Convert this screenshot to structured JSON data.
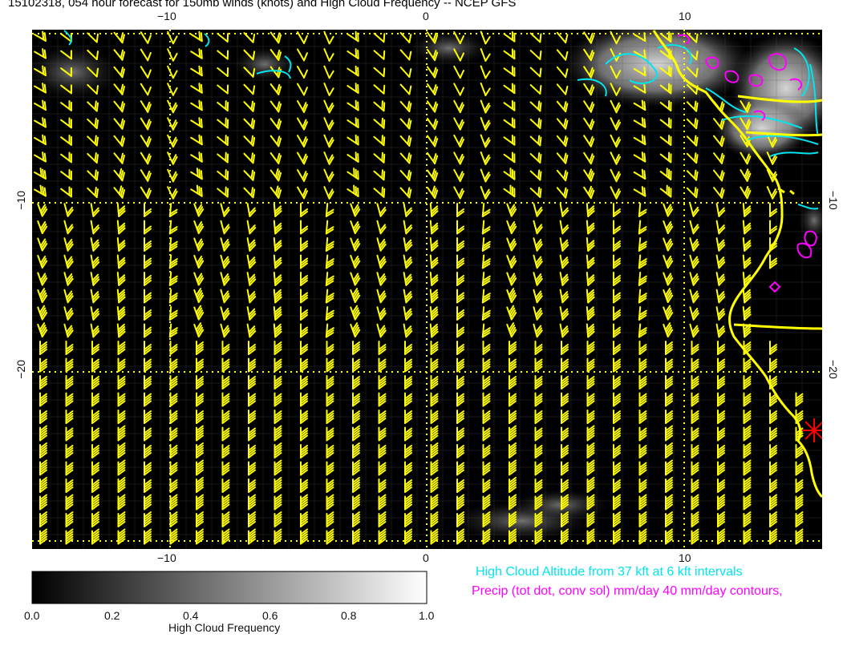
{
  "title": "15102318, 054 hour forecast for 150mb winds (knots) and High Cloud Frequency -- NCEP GFS",
  "axes": {
    "lon_ticks": [
      "−10",
      "0",
      "10"
    ],
    "lat_ticks": [
      "−10",
      "−20"
    ],
    "lon_range": [
      -15.5,
      15.5
    ],
    "lat_range": [
      -29.5,
      -1.5
    ]
  },
  "colorbar": {
    "label": "High Cloud Frequency",
    "ticks": [
      "0.0",
      "0.2",
      "0.4",
      "0.6",
      "0.8",
      "1.0"
    ],
    "range": [
      0.0,
      1.0
    ]
  },
  "legends": {
    "high_cloud": "High Cloud Altitude from 37 kft at 6 kft intervals",
    "precip": "Precip (tot dot, conv sol) mm/day 40 mm/day contours,"
  },
  "colors": {
    "map_background": "#000000",
    "wind_barbs": "#ffff00",
    "coastline": "#ffff00",
    "cloud_altitude_contours": "#00e5ee",
    "precip_contours": "#ff00ff",
    "marker": "#ff0000",
    "grid": "#ffff00"
  },
  "marker": {
    "type": "asterisk",
    "lon": 15.5,
    "lat": -24.5
  }
}
